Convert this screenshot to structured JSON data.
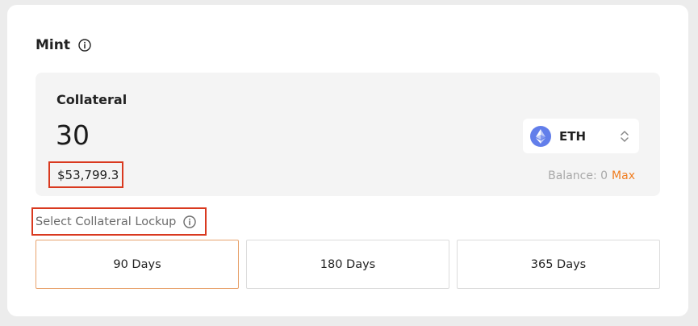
{
  "mint": {
    "title": "Mint",
    "info_icon": "info-icon"
  },
  "collateral": {
    "title": "Collateral",
    "amount": "30",
    "usd_value": "$53,799.3",
    "token": {
      "symbol": "ETH",
      "icon": "ethereum-icon",
      "selector_icon": "chevron-up-down-icon"
    },
    "balance_label": "Balance: 0",
    "max_label": "Max"
  },
  "lockup": {
    "label": "Select Collateral Lockup",
    "info_icon": "info-icon",
    "options": [
      {
        "label": "90 Days",
        "selected": true
      },
      {
        "label": "180 Days",
        "selected": false
      },
      {
        "label": "365 Days",
        "selected": false
      }
    ]
  },
  "colors": {
    "accent_orange": "#f07d20",
    "highlight_red": "#d9391f",
    "selected_border": "#e8a36e",
    "eth_blue": "#627eea",
    "panel_bg": "#f4f4f4"
  }
}
